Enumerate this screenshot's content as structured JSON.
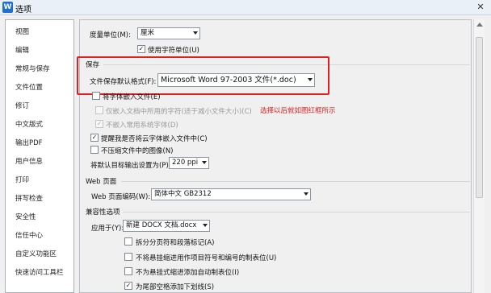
{
  "window": {
    "title": "选项",
    "app_icon": "W",
    "close": "✕"
  },
  "sidebar": {
    "items": [
      "视图",
      "编辑",
      "常规与保存",
      "文件位置",
      "修订",
      "中文版式",
      "输出PDF",
      "用户信息",
      "打印",
      "拼写检查",
      "安全性",
      "信任中心",
      "自定义功能区",
      "快速访问工具栏"
    ]
  },
  "general": {
    "measure_label": "度量单位(M):",
    "measure_value": "厘米",
    "use_char_unit": "使用字符单位(U)",
    "use_char_unit_checked": "✓"
  },
  "save": {
    "section": "保存",
    "format_label": "文件保存默认格式(F):",
    "format_value": "Microsoft Word 97-2003 文件(*.doc)",
    "embed_fonts": "将字体嵌入文件(E)",
    "embed_used_chars": "仅嵌入文档中所用的字符(适于减小文件大小)(C)",
    "no_embed_system": "不嵌入常用系统字体(D)",
    "no_embed_system_checked": "✓",
    "remind_cloud": "提醒我是否将云字体嵌入文件中(C)",
    "remind_cloud_checked": "✓",
    "no_compress": "不压缩文件中的图像(N)",
    "target_output_label": "将默认目标输出设置为(P):",
    "target_output_value": "220 ppi"
  },
  "annotation": "选择以后就如图红框所示",
  "web": {
    "section": "Web 页面",
    "encoding_label": "Web 页面编码(W):",
    "encoding_value": "简体中文 GB2312"
  },
  "compat": {
    "section": "兼容性选项",
    "apply_label": "应用于(Y):",
    "apply_value": "新建 DOCX 文档.docx",
    "options": [
      {
        "label": "拆分分页符和段落标记(A)",
        "check": ""
      },
      {
        "label": "不将悬挂缩进用作项目符号和编号的制表位(U)",
        "check": ""
      },
      {
        "label": "不为悬挂式缩进添加自动制表位(I)",
        "check": ""
      },
      {
        "label": "为尾部空格添加下划线(S)",
        "check": "✓"
      }
    ]
  }
}
